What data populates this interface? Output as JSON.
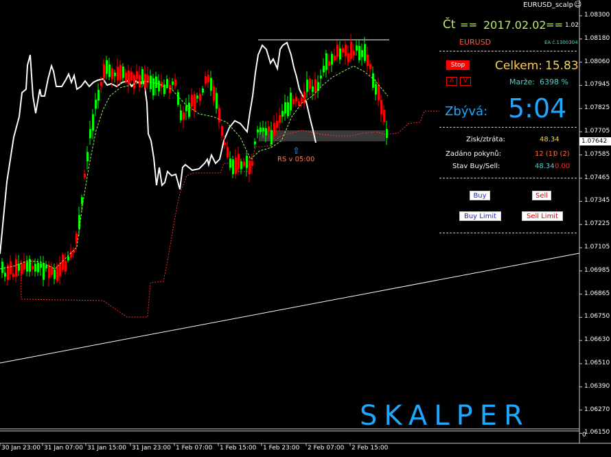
{
  "window": {
    "symbol_title": "EURUSD_scalp"
  },
  "panel": {
    "day": "Čt",
    "eq1": "==",
    "date": "2017.02.02",
    "eq2": "==",
    "version": "1.02",
    "symbol": "EURUSD",
    "ea_label": "EA č.1300304",
    "stop_label": "Stop",
    "up_label": "Λ",
    "down_label": "V",
    "celkem_label": "Celkem:",
    "celkem_value": "15.83",
    "marze_label": "Marže:",
    "marze_value": "6398 %",
    "zbyva_label": "Zbývá:",
    "zbyva_time": "5:04",
    "zisk_label": "Zisk/ztráta:",
    "zisk_value": "48.34",
    "pokyny_label": "Zadáno pokynů:",
    "pokyny_buy": "12 (1)",
    "pokyny_sell": "0 (2)",
    "stav_label": "Stav Buy/Sell:",
    "stav_buy": "48.34",
    "stav_sell": "0.00",
    "buy_label": "Buy",
    "sell_label": "Sell",
    "buy_limit_label": "Buy Limit",
    "sell_limit_label": "Sell Limit"
  },
  "annotation": {
    "rs_label": "RS v 05:00",
    "arrow": "⇧"
  },
  "watermark": "SKALPER",
  "price_axis": {
    "ticks": [
      "1.08300",
      "1.08180",
      "1.08060",
      "1.07945",
      "1.07825",
      "1.07705",
      "1.07585",
      "1.07465",
      "1.07345",
      "1.07225",
      "1.07105",
      "1.06985",
      "1.06865",
      "1.06750",
      "1.06630",
      "1.06510",
      "1.06390",
      "1.06270",
      "1.06150"
    ],
    "current_price": "1.07642",
    "sub_zero": "0"
  },
  "time_axis": {
    "labels": [
      "30 Jan 23:00",
      "31 Jan 07:00",
      "31 Jan 15:00",
      "31 Jan 23:00",
      "1 Feb 07:00",
      "1 Feb 15:00",
      "1 Feb 23:00",
      "2 Feb 07:00",
      "2 Feb 15:00"
    ]
  },
  "colors": {
    "bull": "#00ff00",
    "bear": "#ff0000",
    "dashed": "#ff2a2a",
    "accent_blue": "#1ea7ff",
    "yellow": "#ffd24a",
    "green_text": "#b8f060",
    "teal": "#56d3c8"
  }
}
